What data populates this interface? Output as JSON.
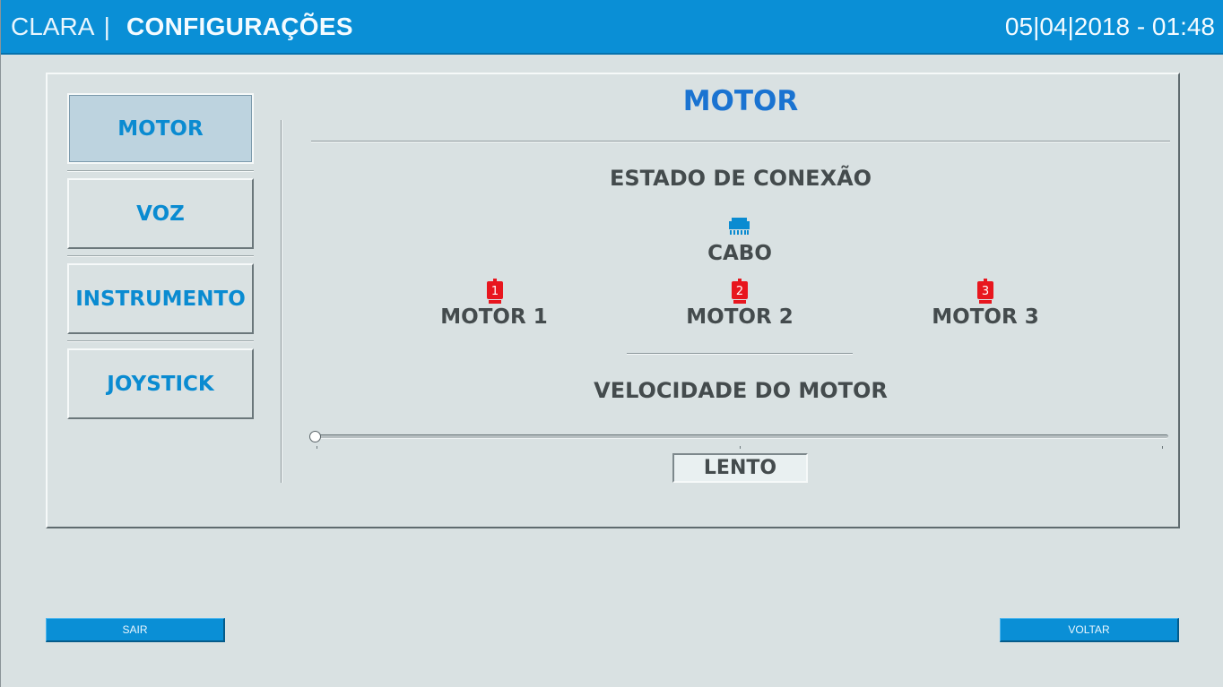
{
  "header": {
    "app_name": "CLARA",
    "separator": "|",
    "title": "CONFIGURAÇÕES",
    "datetime": "05|04|2018 - 01:48"
  },
  "nav": {
    "items": [
      {
        "label": "MOTOR",
        "active": true
      },
      {
        "label": "VOZ",
        "active": false
      },
      {
        "label": "INSTRUMENTO",
        "active": false
      },
      {
        "label": "JOYSTICK",
        "active": false
      }
    ]
  },
  "main": {
    "section_title": "MOTOR",
    "connection_heading": "ESTADO DE CONEXÃO",
    "cable_label": "CABO",
    "motors": [
      {
        "label": "MOTOR 1",
        "number": "1",
        "status_color": "#e8161e"
      },
      {
        "label": "MOTOR 2",
        "number": "2",
        "status_color": "#e8161e"
      },
      {
        "label": "MOTOR 3",
        "number": "3",
        "status_color": "#e8161e"
      }
    ],
    "cable_icon_color": "#0a8bd1",
    "speed_heading": "VELOCIDADE DO MOTOR",
    "speed_value_label": "LENTO",
    "speed_fraction": 0.0
  },
  "footer": {
    "exit_label": "SAIR",
    "back_label": "VOLTAR"
  },
  "colors": {
    "accent": "#0a8fd6",
    "title_blue": "#1a73d1",
    "background": "#d9e1e2"
  },
  "icons": {
    "cable": "ethernet-connector-icon",
    "motor": "motor-disconnected-icon"
  }
}
